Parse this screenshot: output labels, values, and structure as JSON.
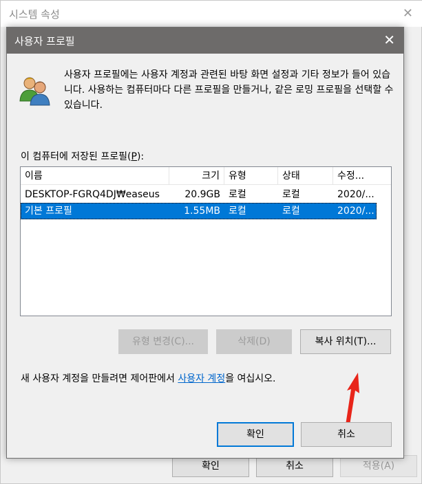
{
  "background_window": {
    "title": "시스템 속성",
    "buttons": {
      "ok": "확인",
      "cancel": "취소",
      "apply": "적용(A)"
    }
  },
  "dialog": {
    "title": "사용자 프로필",
    "description": "사용자 프로필에는 사용자 계정과 관련된 바탕 화면 설정과 기타 정보가 들어 있습니다. 사용하는 컴퓨터마다 다른 프로필을 만들거나, 같은 로밍 프로필을 선택할 수 있습니다.",
    "stored_label_prefix": "이 컴퓨터에 저장된 프로필(",
    "stored_label_key": "P",
    "stored_label_suffix": "):",
    "columns": [
      "이름",
      "크기",
      "유형",
      "상태",
      "수정..."
    ],
    "rows": [
      {
        "name": "DESKTOP-FGRQ4DJ₩easeus",
        "size": "20.9GB",
        "type": "로컬",
        "status": "로컬",
        "modified": "2020/..."
      },
      {
        "name": "기본 프로필",
        "size": "1.55MB",
        "type": "로컬",
        "status": "로컬",
        "modified": "2020/..."
      }
    ],
    "selected_row": 1,
    "buttons": {
      "change_type": "유형 변경(C)...",
      "delete": "삭제(D)",
      "copy_to": "복사 위치(T)...",
      "ok": "확인",
      "cancel": "취소"
    },
    "new_account_prefix": "새 사용자 계정을 만들려면 제어판에서 ",
    "new_account_link": "사용자 계정",
    "new_account_suffix": "을 여십시오."
  },
  "colors": {
    "titlebar": "#6d6b6a",
    "selection": "#0078d7",
    "link": "#0066cc",
    "annotation_arrow": "#e8251a"
  },
  "icons": {
    "users": "users-icon",
    "close": "close-icon",
    "annotation": "red-arrow-icon"
  }
}
